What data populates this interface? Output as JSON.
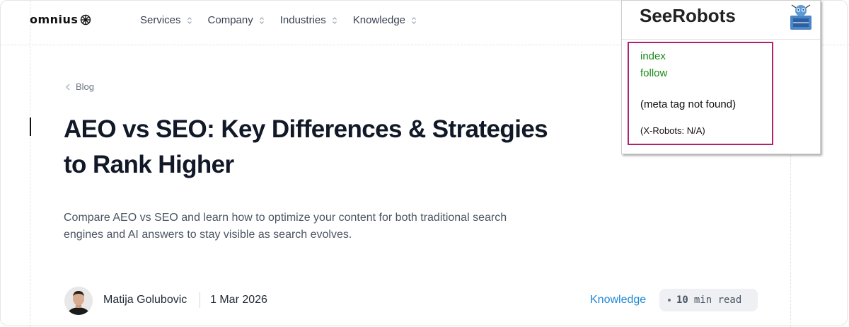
{
  "header": {
    "logo_text": "omnius",
    "nav": [
      {
        "label": "Services"
      },
      {
        "label": "Company"
      },
      {
        "label": "Industries"
      },
      {
        "label": "Knowledge"
      }
    ]
  },
  "breadcrumb": {
    "label": "Blog"
  },
  "article": {
    "title": "AEO vs SEO: Key Differences & Strategies to Rank Higher",
    "description": "Compare AEO vs SEO and learn how to optimize your content for both traditional search engines and AI answers to stay visible as search evolves.",
    "author": "Matija Golubovic",
    "date": "1 Mar 2026",
    "category": "Knowledge",
    "read_time_number": "10",
    "read_time_unit": "min read"
  },
  "extension": {
    "title": "SeeRobots",
    "index": "index",
    "follow": "follow",
    "meta_status": "(meta tag not found)",
    "x_robots": "(X-Robots: N/A)",
    "colors": {
      "border": "#b0226c",
      "green": "#1a8a1a"
    }
  },
  "colors": {
    "link": "#1e88d6",
    "text": "#111827"
  }
}
